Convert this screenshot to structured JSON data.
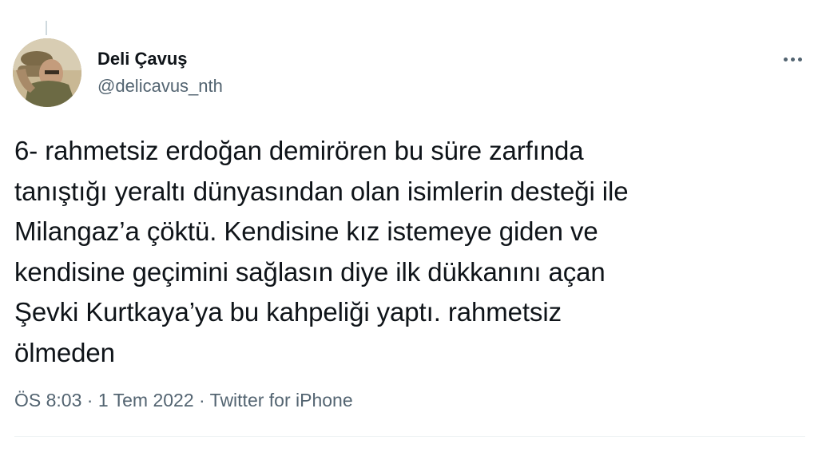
{
  "tweet": {
    "author": {
      "display_name": "Deli Çavuş",
      "handle": "@delicavus_nth"
    },
    "text": "6- rahmetsiz erdoğan demirören bu süre zarfında\ntanıştığı yeraltı dünyasından olan isimlerin desteği ile\nMilangaz’a çöktü. Kendisine kız istemeye giden ve\nkendisine geçimini sağlasın diye ilk dükkanını açan\nŞevki Kurtkaya’ya bu kahpeliği yaptı. rahmetsiz\nölmeden",
    "time": "ÖS 8:03",
    "separator": "·",
    "date": "1 Tem 2022",
    "source": "Twitter for iPhone"
  },
  "icons": {
    "more": "more-horizontal-icon"
  },
  "colors": {
    "text": "#0f1419",
    "secondary": "#536471",
    "divider": "#eff3f4"
  }
}
